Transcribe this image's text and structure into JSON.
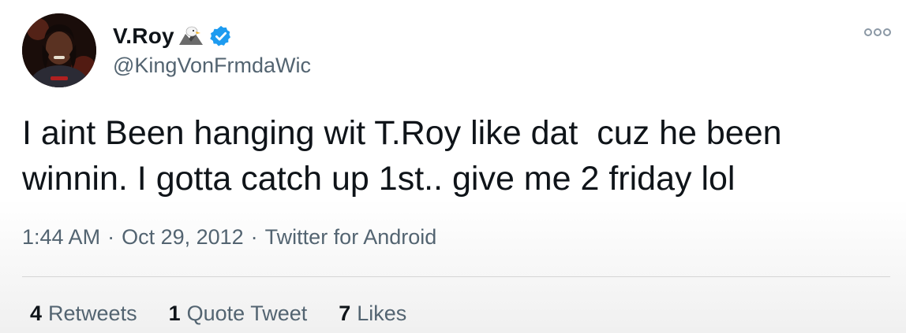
{
  "author": {
    "display_name": "V.Roy",
    "handle": "@KingVonFrmdaWic",
    "emoji_icon": "eagle-icon",
    "verified_icon": "verified-badge-icon",
    "verified_color": "#1d9bf0"
  },
  "tweet": {
    "text": "I aint Been hanging wit T.Roy like dat  cuz he been winnin. I gotta catch up 1st.. give me 2 friday lol",
    "time": "1:44 AM",
    "separator": "·",
    "date": "Oct 29, 2012",
    "source": "Twitter for Android"
  },
  "stats": {
    "retweets_count": "4",
    "retweets_label": "Retweets",
    "quotes_count": "1",
    "quotes_label": "Quote Tweet",
    "likes_count": "7",
    "likes_label": "Likes"
  },
  "icons": {
    "more": "more-options-icon"
  }
}
